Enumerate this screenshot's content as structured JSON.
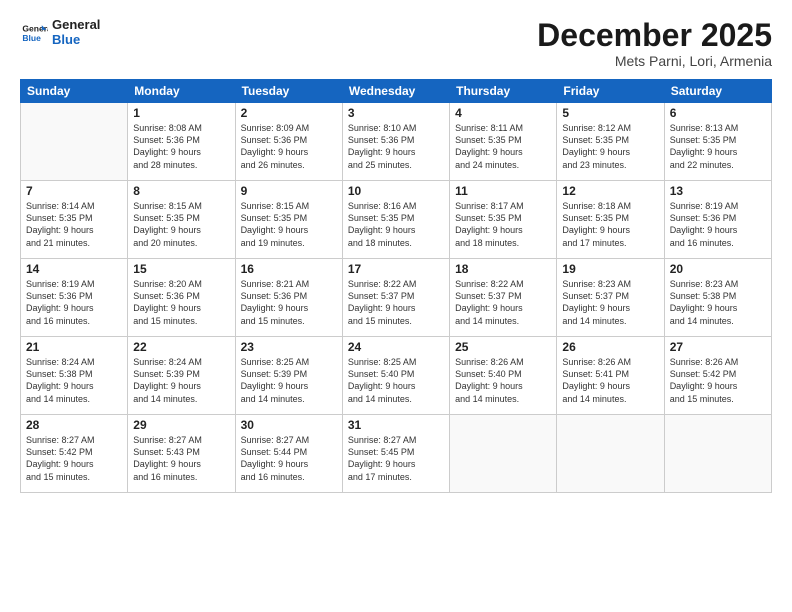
{
  "header": {
    "logo_line1": "General",
    "logo_line2": "Blue",
    "month": "December 2025",
    "location": "Mets Parni, Lori, Armenia"
  },
  "days_of_week": [
    "Sunday",
    "Monday",
    "Tuesday",
    "Wednesday",
    "Thursday",
    "Friday",
    "Saturday"
  ],
  "weeks": [
    [
      {
        "day": "",
        "info": ""
      },
      {
        "day": "1",
        "info": "Sunrise: 8:08 AM\nSunset: 5:36 PM\nDaylight: 9 hours\nand 28 minutes."
      },
      {
        "day": "2",
        "info": "Sunrise: 8:09 AM\nSunset: 5:36 PM\nDaylight: 9 hours\nand 26 minutes."
      },
      {
        "day": "3",
        "info": "Sunrise: 8:10 AM\nSunset: 5:36 PM\nDaylight: 9 hours\nand 25 minutes."
      },
      {
        "day": "4",
        "info": "Sunrise: 8:11 AM\nSunset: 5:35 PM\nDaylight: 9 hours\nand 24 minutes."
      },
      {
        "day": "5",
        "info": "Sunrise: 8:12 AM\nSunset: 5:35 PM\nDaylight: 9 hours\nand 23 minutes."
      },
      {
        "day": "6",
        "info": "Sunrise: 8:13 AM\nSunset: 5:35 PM\nDaylight: 9 hours\nand 22 minutes."
      }
    ],
    [
      {
        "day": "7",
        "info": "Sunrise: 8:14 AM\nSunset: 5:35 PM\nDaylight: 9 hours\nand 21 minutes."
      },
      {
        "day": "8",
        "info": "Sunrise: 8:15 AM\nSunset: 5:35 PM\nDaylight: 9 hours\nand 20 minutes."
      },
      {
        "day": "9",
        "info": "Sunrise: 8:15 AM\nSunset: 5:35 PM\nDaylight: 9 hours\nand 19 minutes."
      },
      {
        "day": "10",
        "info": "Sunrise: 8:16 AM\nSunset: 5:35 PM\nDaylight: 9 hours\nand 18 minutes."
      },
      {
        "day": "11",
        "info": "Sunrise: 8:17 AM\nSunset: 5:35 PM\nDaylight: 9 hours\nand 18 minutes."
      },
      {
        "day": "12",
        "info": "Sunrise: 8:18 AM\nSunset: 5:35 PM\nDaylight: 9 hours\nand 17 minutes."
      },
      {
        "day": "13",
        "info": "Sunrise: 8:19 AM\nSunset: 5:36 PM\nDaylight: 9 hours\nand 16 minutes."
      }
    ],
    [
      {
        "day": "14",
        "info": "Sunrise: 8:19 AM\nSunset: 5:36 PM\nDaylight: 9 hours\nand 16 minutes."
      },
      {
        "day": "15",
        "info": "Sunrise: 8:20 AM\nSunset: 5:36 PM\nDaylight: 9 hours\nand 15 minutes."
      },
      {
        "day": "16",
        "info": "Sunrise: 8:21 AM\nSunset: 5:36 PM\nDaylight: 9 hours\nand 15 minutes."
      },
      {
        "day": "17",
        "info": "Sunrise: 8:22 AM\nSunset: 5:37 PM\nDaylight: 9 hours\nand 15 minutes."
      },
      {
        "day": "18",
        "info": "Sunrise: 8:22 AM\nSunset: 5:37 PM\nDaylight: 9 hours\nand 14 minutes."
      },
      {
        "day": "19",
        "info": "Sunrise: 8:23 AM\nSunset: 5:37 PM\nDaylight: 9 hours\nand 14 minutes."
      },
      {
        "day": "20",
        "info": "Sunrise: 8:23 AM\nSunset: 5:38 PM\nDaylight: 9 hours\nand 14 minutes."
      }
    ],
    [
      {
        "day": "21",
        "info": "Sunrise: 8:24 AM\nSunset: 5:38 PM\nDaylight: 9 hours\nand 14 minutes."
      },
      {
        "day": "22",
        "info": "Sunrise: 8:24 AM\nSunset: 5:39 PM\nDaylight: 9 hours\nand 14 minutes."
      },
      {
        "day": "23",
        "info": "Sunrise: 8:25 AM\nSunset: 5:39 PM\nDaylight: 9 hours\nand 14 minutes."
      },
      {
        "day": "24",
        "info": "Sunrise: 8:25 AM\nSunset: 5:40 PM\nDaylight: 9 hours\nand 14 minutes."
      },
      {
        "day": "25",
        "info": "Sunrise: 8:26 AM\nSunset: 5:40 PM\nDaylight: 9 hours\nand 14 minutes."
      },
      {
        "day": "26",
        "info": "Sunrise: 8:26 AM\nSunset: 5:41 PM\nDaylight: 9 hours\nand 14 minutes."
      },
      {
        "day": "27",
        "info": "Sunrise: 8:26 AM\nSunset: 5:42 PM\nDaylight: 9 hours\nand 15 minutes."
      }
    ],
    [
      {
        "day": "28",
        "info": "Sunrise: 8:27 AM\nSunset: 5:42 PM\nDaylight: 9 hours\nand 15 minutes."
      },
      {
        "day": "29",
        "info": "Sunrise: 8:27 AM\nSunset: 5:43 PM\nDaylight: 9 hours\nand 16 minutes."
      },
      {
        "day": "30",
        "info": "Sunrise: 8:27 AM\nSunset: 5:44 PM\nDaylight: 9 hours\nand 16 minutes."
      },
      {
        "day": "31",
        "info": "Sunrise: 8:27 AM\nSunset: 5:45 PM\nDaylight: 9 hours\nand 17 minutes."
      },
      {
        "day": "",
        "info": ""
      },
      {
        "day": "",
        "info": ""
      },
      {
        "day": "",
        "info": ""
      }
    ]
  ]
}
